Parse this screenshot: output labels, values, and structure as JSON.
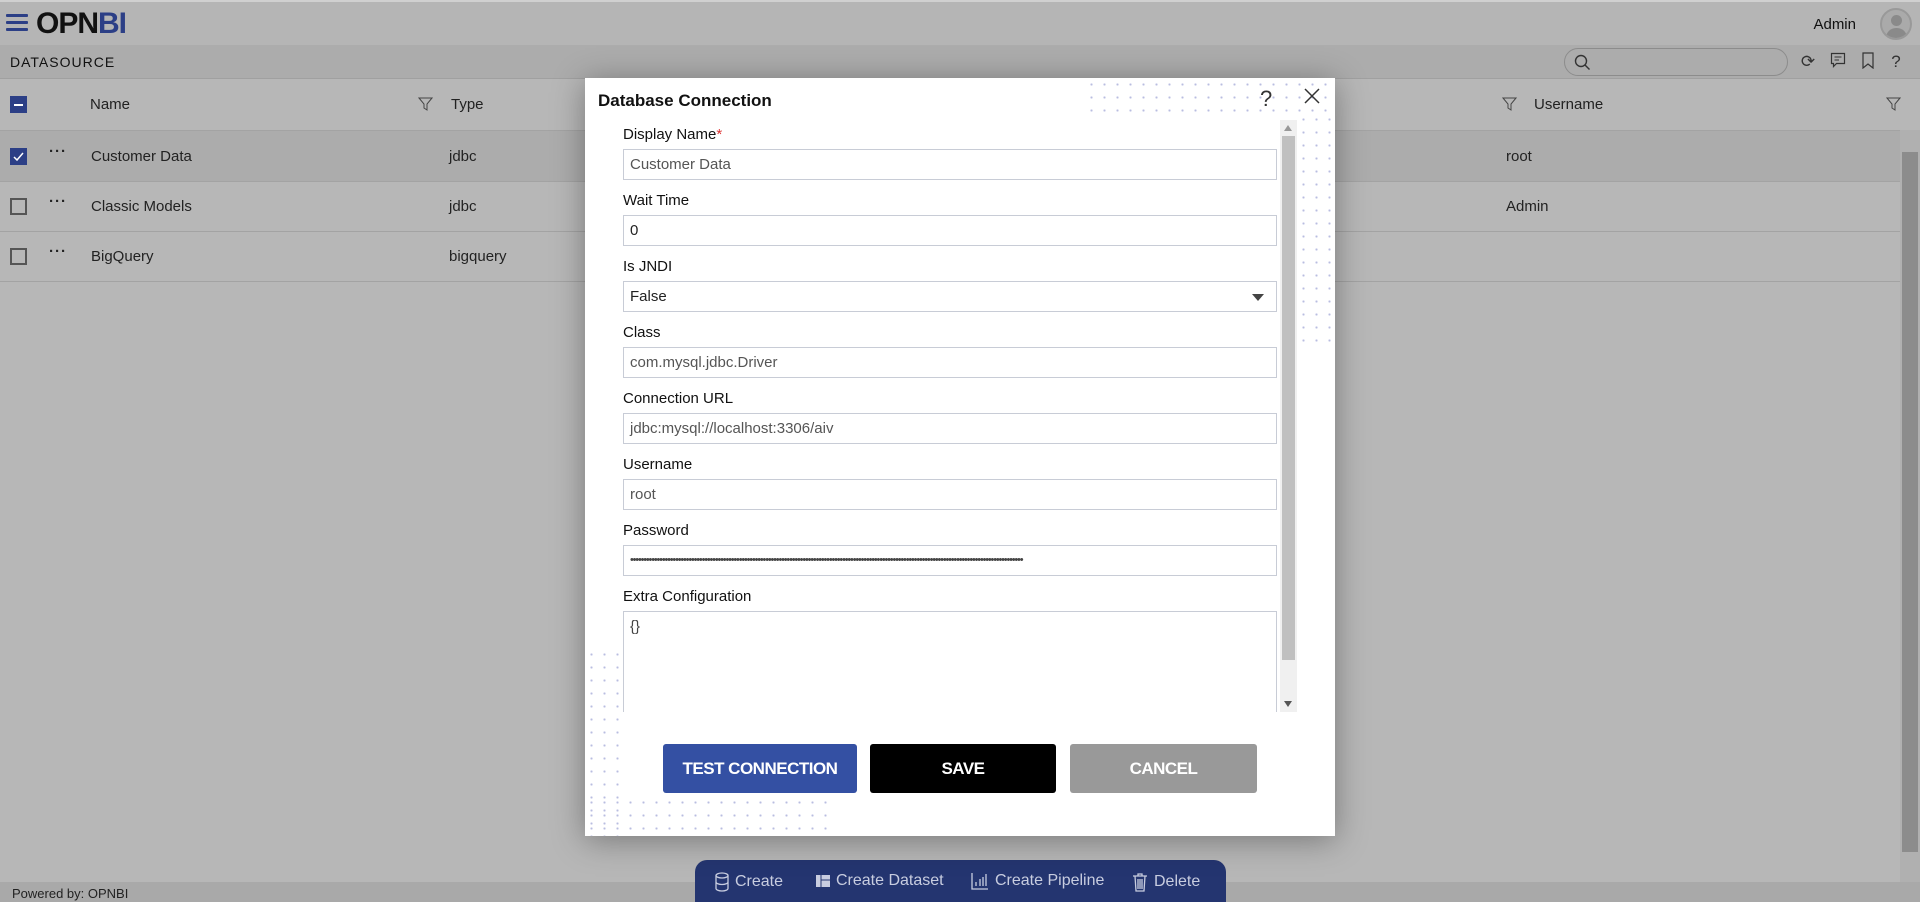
{
  "header": {
    "logo_prefix": "OPN",
    "logo_suffix": "BI",
    "user": "Admin"
  },
  "subheader": {
    "title": "DATASOURCE",
    "search_placeholder": ""
  },
  "table": {
    "columns": [
      "Name",
      "Type",
      "Username"
    ],
    "rows": [
      {
        "name": "Customer Data",
        "type": "jdbc",
        "username": "root",
        "checked": true
      },
      {
        "name": "Classic Models",
        "type": "jdbc",
        "username": "Admin",
        "checked": false
      },
      {
        "name": "BigQuery",
        "type": "bigquery",
        "username": "",
        "checked": false
      }
    ]
  },
  "modal": {
    "title": "Database Connection",
    "help": "?",
    "fields": [
      {
        "label": "Display Name",
        "required_mark": "*",
        "value": "Customer Data"
      },
      {
        "label": "Wait Time",
        "value": "0"
      },
      {
        "label": "Is JNDI",
        "value": "False"
      },
      {
        "label": "Class",
        "value": "com.mysql.jdbc.Driver"
      },
      {
        "label": "Connection URL",
        "value": "jdbc:mysql://localhost:3306/aiv"
      },
      {
        "label": "Username",
        "value": "root"
      },
      {
        "label": "Password",
        "value": "••••••••••••••••••••••••••••••••••••••••••••••••••••••••••••••••••••••••••••••••••••••••••••••••••••••••••••••••••••••••••••••••••••••••••••••••••••"
      },
      {
        "label": "Extra Configuration",
        "value": "{}"
      }
    ],
    "buttons": {
      "test": "TEST CONNECTION",
      "save": "SAVE",
      "cancel": "CANCEL"
    },
    "colors": {
      "test": "#3450a3",
      "save": "#000000",
      "cancel": "#999999"
    }
  },
  "bottombar": {
    "create": "Create",
    "create_dataset": "Create Dataset",
    "create_pipeline": "Create Pipeline",
    "delete": "Delete"
  },
  "footer": {
    "text": "Powered by: OPNBI"
  }
}
